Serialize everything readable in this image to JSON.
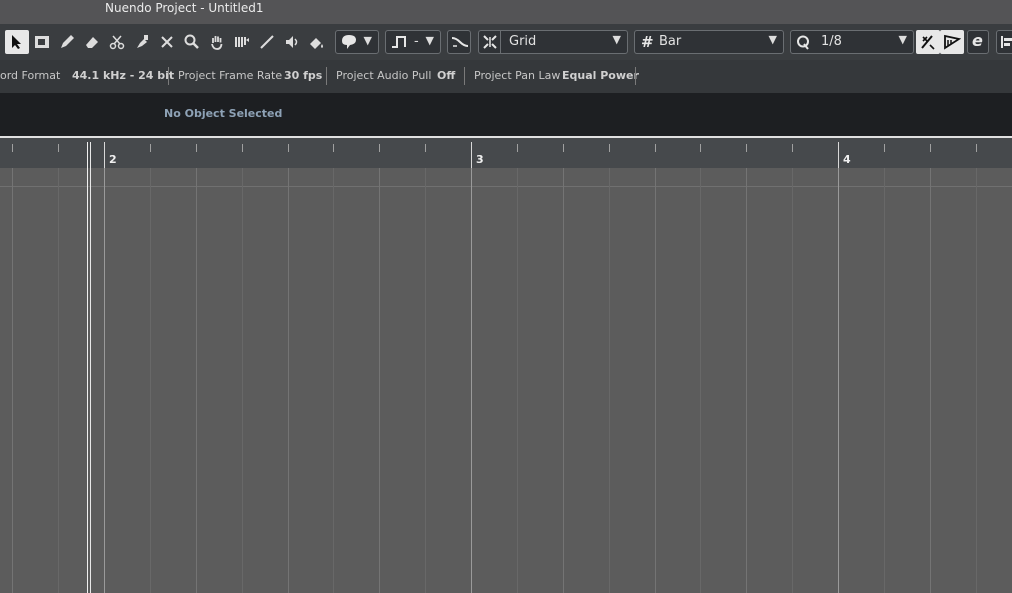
{
  "window": {
    "title": "Nuendo Project - Untitled1"
  },
  "toolbar": {
    "snap_dropdown": {
      "label": "Grid"
    },
    "grid_dropdown": {
      "label": "Bar"
    },
    "quantize_dropdown": {
      "label": "1/8"
    },
    "auto_scroll_label": "-"
  },
  "info_bar": {
    "record_format_label": "ord Format",
    "record_format_value": "44.1 kHz - 24 bit",
    "frame_rate_label": "Project Frame Rate",
    "frame_rate_value": "30 fps",
    "audio_pull_label": "Project Audio Pull",
    "audio_pull_value": "Off",
    "pan_law_label": "Project Pan Law",
    "pan_law_value": "Equal Power"
  },
  "object_bar": {
    "message": "No Object Selected"
  },
  "ruler": {
    "bars": [
      "2",
      "3",
      "4"
    ]
  },
  "icons": [
    "object-selection-icon",
    "range-selection-icon",
    "draw-icon",
    "erase-icon",
    "split-icon",
    "glue-icon",
    "delete-icon",
    "zoom-icon",
    "hand-icon",
    "comp-icon",
    "line-icon",
    "play-icon",
    "color-icon",
    "automation-icon",
    "auto-scroll-icon",
    "snap-on-zero-icon",
    "snap-icon",
    "grid-icon",
    "quantize-icon",
    "iterative-quantize-icon",
    "audiowarp-quantize-icon",
    "edit-in-place-icon"
  ]
}
